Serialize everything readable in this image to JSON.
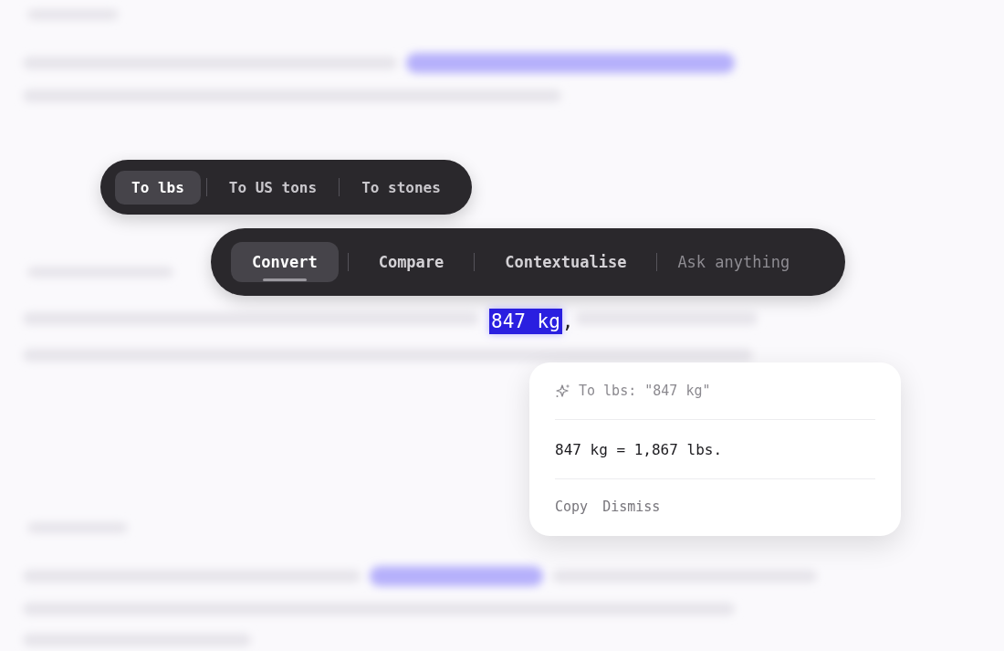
{
  "unit_options": [
    {
      "label": "To lbs",
      "selected": true
    },
    {
      "label": "To US tons",
      "selected": false
    },
    {
      "label": "To stones",
      "selected": false
    }
  ],
  "actions": [
    {
      "label": "Convert",
      "selected": true
    },
    {
      "label": "Compare",
      "selected": false
    },
    {
      "label": "Contextualise",
      "selected": false
    }
  ],
  "prompt": {
    "placeholder": "Ask anything"
  },
  "selection": {
    "text": "847 kg",
    "after": ","
  },
  "result": {
    "query": "To lbs: \"847 kg\"",
    "answer": "847 kg = 1,867 lbs.",
    "buttons": [
      "Copy",
      "Dismiss"
    ]
  }
}
